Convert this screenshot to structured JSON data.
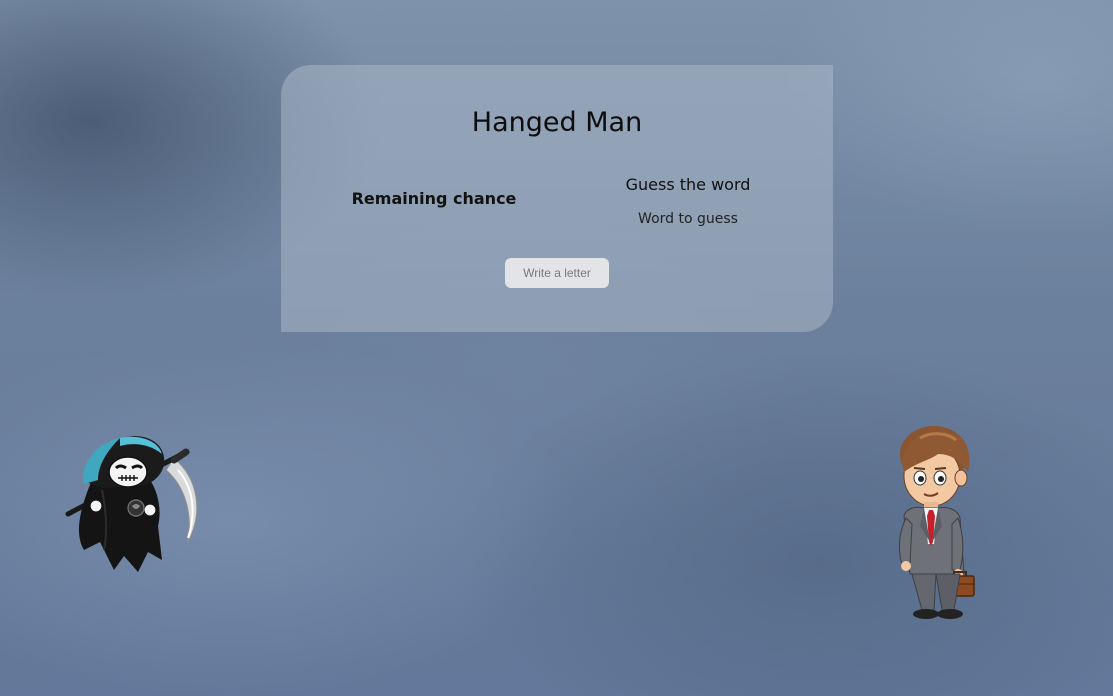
{
  "game": {
    "title": "Hanged Man",
    "remaining_label": "Remaining chance",
    "guess_heading": "Guess the word",
    "word_display": "Word to guess",
    "input_placeholder": "Write a letter"
  },
  "characters": {
    "left_icon": "grim-reaper",
    "right_icon": "businessman"
  }
}
